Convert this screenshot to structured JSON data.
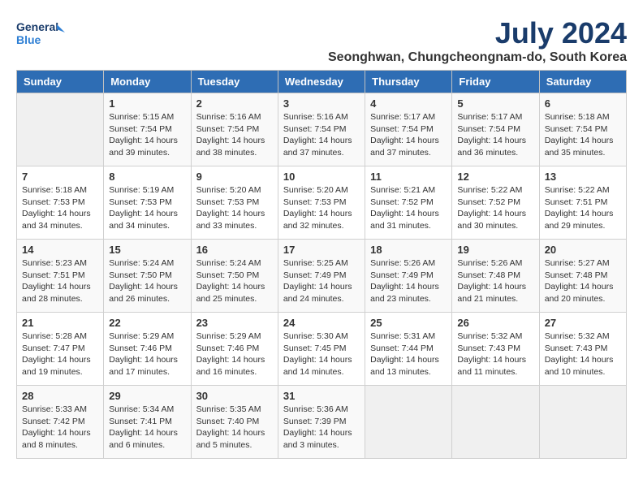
{
  "logo": {
    "text_general": "General",
    "text_blue": "Blue"
  },
  "title": "July 2024",
  "location": "Seonghwan, Chungcheongnam-do, South Korea",
  "days_of_week": [
    "Sunday",
    "Monday",
    "Tuesday",
    "Wednesday",
    "Thursday",
    "Friday",
    "Saturday"
  ],
  "weeks": [
    [
      {
        "day": "",
        "info": ""
      },
      {
        "day": "1",
        "info": "Sunrise: 5:15 AM\nSunset: 7:54 PM\nDaylight: 14 hours\nand 39 minutes."
      },
      {
        "day": "2",
        "info": "Sunrise: 5:16 AM\nSunset: 7:54 PM\nDaylight: 14 hours\nand 38 minutes."
      },
      {
        "day": "3",
        "info": "Sunrise: 5:16 AM\nSunset: 7:54 PM\nDaylight: 14 hours\nand 37 minutes."
      },
      {
        "day": "4",
        "info": "Sunrise: 5:17 AM\nSunset: 7:54 PM\nDaylight: 14 hours\nand 37 minutes."
      },
      {
        "day": "5",
        "info": "Sunrise: 5:17 AM\nSunset: 7:54 PM\nDaylight: 14 hours\nand 36 minutes."
      },
      {
        "day": "6",
        "info": "Sunrise: 5:18 AM\nSunset: 7:54 PM\nDaylight: 14 hours\nand 35 minutes."
      }
    ],
    [
      {
        "day": "7",
        "info": "Sunrise: 5:18 AM\nSunset: 7:53 PM\nDaylight: 14 hours\nand 34 minutes."
      },
      {
        "day": "8",
        "info": "Sunrise: 5:19 AM\nSunset: 7:53 PM\nDaylight: 14 hours\nand 34 minutes."
      },
      {
        "day": "9",
        "info": "Sunrise: 5:20 AM\nSunset: 7:53 PM\nDaylight: 14 hours\nand 33 minutes."
      },
      {
        "day": "10",
        "info": "Sunrise: 5:20 AM\nSunset: 7:53 PM\nDaylight: 14 hours\nand 32 minutes."
      },
      {
        "day": "11",
        "info": "Sunrise: 5:21 AM\nSunset: 7:52 PM\nDaylight: 14 hours\nand 31 minutes."
      },
      {
        "day": "12",
        "info": "Sunrise: 5:22 AM\nSunset: 7:52 PM\nDaylight: 14 hours\nand 30 minutes."
      },
      {
        "day": "13",
        "info": "Sunrise: 5:22 AM\nSunset: 7:51 PM\nDaylight: 14 hours\nand 29 minutes."
      }
    ],
    [
      {
        "day": "14",
        "info": "Sunrise: 5:23 AM\nSunset: 7:51 PM\nDaylight: 14 hours\nand 28 minutes."
      },
      {
        "day": "15",
        "info": "Sunrise: 5:24 AM\nSunset: 7:50 PM\nDaylight: 14 hours\nand 26 minutes."
      },
      {
        "day": "16",
        "info": "Sunrise: 5:24 AM\nSunset: 7:50 PM\nDaylight: 14 hours\nand 25 minutes."
      },
      {
        "day": "17",
        "info": "Sunrise: 5:25 AM\nSunset: 7:49 PM\nDaylight: 14 hours\nand 24 minutes."
      },
      {
        "day": "18",
        "info": "Sunrise: 5:26 AM\nSunset: 7:49 PM\nDaylight: 14 hours\nand 23 minutes."
      },
      {
        "day": "19",
        "info": "Sunrise: 5:26 AM\nSunset: 7:48 PM\nDaylight: 14 hours\nand 21 minutes."
      },
      {
        "day": "20",
        "info": "Sunrise: 5:27 AM\nSunset: 7:48 PM\nDaylight: 14 hours\nand 20 minutes."
      }
    ],
    [
      {
        "day": "21",
        "info": "Sunrise: 5:28 AM\nSunset: 7:47 PM\nDaylight: 14 hours\nand 19 minutes."
      },
      {
        "day": "22",
        "info": "Sunrise: 5:29 AM\nSunset: 7:46 PM\nDaylight: 14 hours\nand 17 minutes."
      },
      {
        "day": "23",
        "info": "Sunrise: 5:29 AM\nSunset: 7:46 PM\nDaylight: 14 hours\nand 16 minutes."
      },
      {
        "day": "24",
        "info": "Sunrise: 5:30 AM\nSunset: 7:45 PM\nDaylight: 14 hours\nand 14 minutes."
      },
      {
        "day": "25",
        "info": "Sunrise: 5:31 AM\nSunset: 7:44 PM\nDaylight: 14 hours\nand 13 minutes."
      },
      {
        "day": "26",
        "info": "Sunrise: 5:32 AM\nSunset: 7:43 PM\nDaylight: 14 hours\nand 11 minutes."
      },
      {
        "day": "27",
        "info": "Sunrise: 5:32 AM\nSunset: 7:43 PM\nDaylight: 14 hours\nand 10 minutes."
      }
    ],
    [
      {
        "day": "28",
        "info": "Sunrise: 5:33 AM\nSunset: 7:42 PM\nDaylight: 14 hours\nand 8 minutes."
      },
      {
        "day": "29",
        "info": "Sunrise: 5:34 AM\nSunset: 7:41 PM\nDaylight: 14 hours\nand 6 minutes."
      },
      {
        "day": "30",
        "info": "Sunrise: 5:35 AM\nSunset: 7:40 PM\nDaylight: 14 hours\nand 5 minutes."
      },
      {
        "day": "31",
        "info": "Sunrise: 5:36 AM\nSunset: 7:39 PM\nDaylight: 14 hours\nand 3 minutes."
      },
      {
        "day": "",
        "info": ""
      },
      {
        "day": "",
        "info": ""
      },
      {
        "day": "",
        "info": ""
      }
    ]
  ]
}
